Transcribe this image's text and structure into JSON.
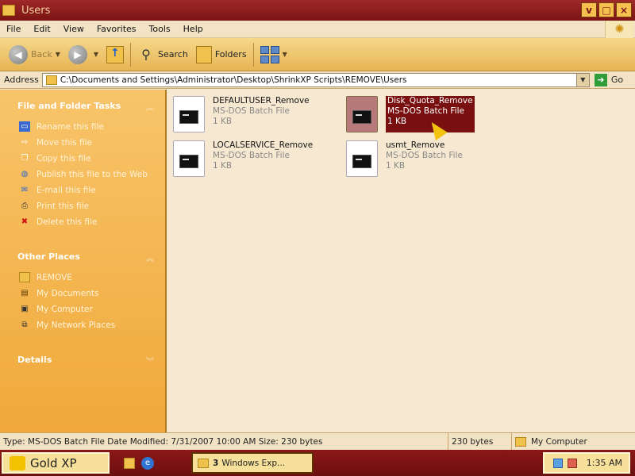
{
  "window": {
    "title": "Users",
    "buttons": [
      "v",
      "□",
      "×"
    ]
  },
  "menu": [
    "File",
    "Edit",
    "View",
    "Favorites",
    "Tools",
    "Help"
  ],
  "toolbar": {
    "back": "Back",
    "search": "Search",
    "folders": "Folders"
  },
  "address": {
    "label": "Address",
    "path": "C:\\Documents and Settings\\Administrator\\Desktop\\ShrinkXP Scripts\\REMOVE\\Users",
    "go": "Go"
  },
  "taskpane": {
    "file_tasks_title": "File and Folder Tasks",
    "file_tasks": [
      {
        "label": "Rename this file",
        "icon": "rename-icon"
      },
      {
        "label": "Move this file",
        "icon": "move-icon"
      },
      {
        "label": "Copy this file",
        "icon": "copy-icon"
      },
      {
        "label": "Publish this file to the Web",
        "icon": "globe-icon"
      },
      {
        "label": "E-mail this file",
        "icon": "email-icon"
      },
      {
        "label": "Print this file",
        "icon": "printer-icon"
      },
      {
        "label": "Delete this file",
        "icon": "delete-icon"
      }
    ],
    "other_places_title": "Other Places",
    "other_places": [
      {
        "label": "REMOVE",
        "icon": "folder-icon"
      },
      {
        "label": "My Documents",
        "icon": "my-documents-icon"
      },
      {
        "label": "My Computer",
        "icon": "my-computer-icon"
      },
      {
        "label": "My Network Places",
        "icon": "network-icon"
      }
    ],
    "details_title": "Details"
  },
  "files": [
    {
      "name": "DEFAULTUSER_Remove",
      "type": "MS-DOS Batch File",
      "size": "1 KB",
      "selected": false
    },
    {
      "name": "Disk_Quota_Remove",
      "type": "MS-DOS Batch File",
      "size": "1 KB",
      "selected": true
    },
    {
      "name": "LOCALSERVICE_Remove",
      "type": "MS-DOS Batch File",
      "size": "1 KB",
      "selected": false
    },
    {
      "name": "usmt_Remove",
      "type": "MS-DOS Batch File",
      "size": "1 KB",
      "selected": false
    }
  ],
  "status": {
    "info": "Type: MS-DOS Batch File Date Modified: 7/31/2007 10:00 AM Size: 230 bytes",
    "size": "230 bytes",
    "location": "My Computer"
  },
  "taskbar": {
    "start": "Gold XP",
    "task_count": "3",
    "task_label": "Windows Exp...",
    "clock": "1:35 AM"
  },
  "colors": {
    "title_bar": "#8a1a1a",
    "task_pane": "#f5b650",
    "selection": "#7a0f0f",
    "taskbar": "#7a1414"
  }
}
